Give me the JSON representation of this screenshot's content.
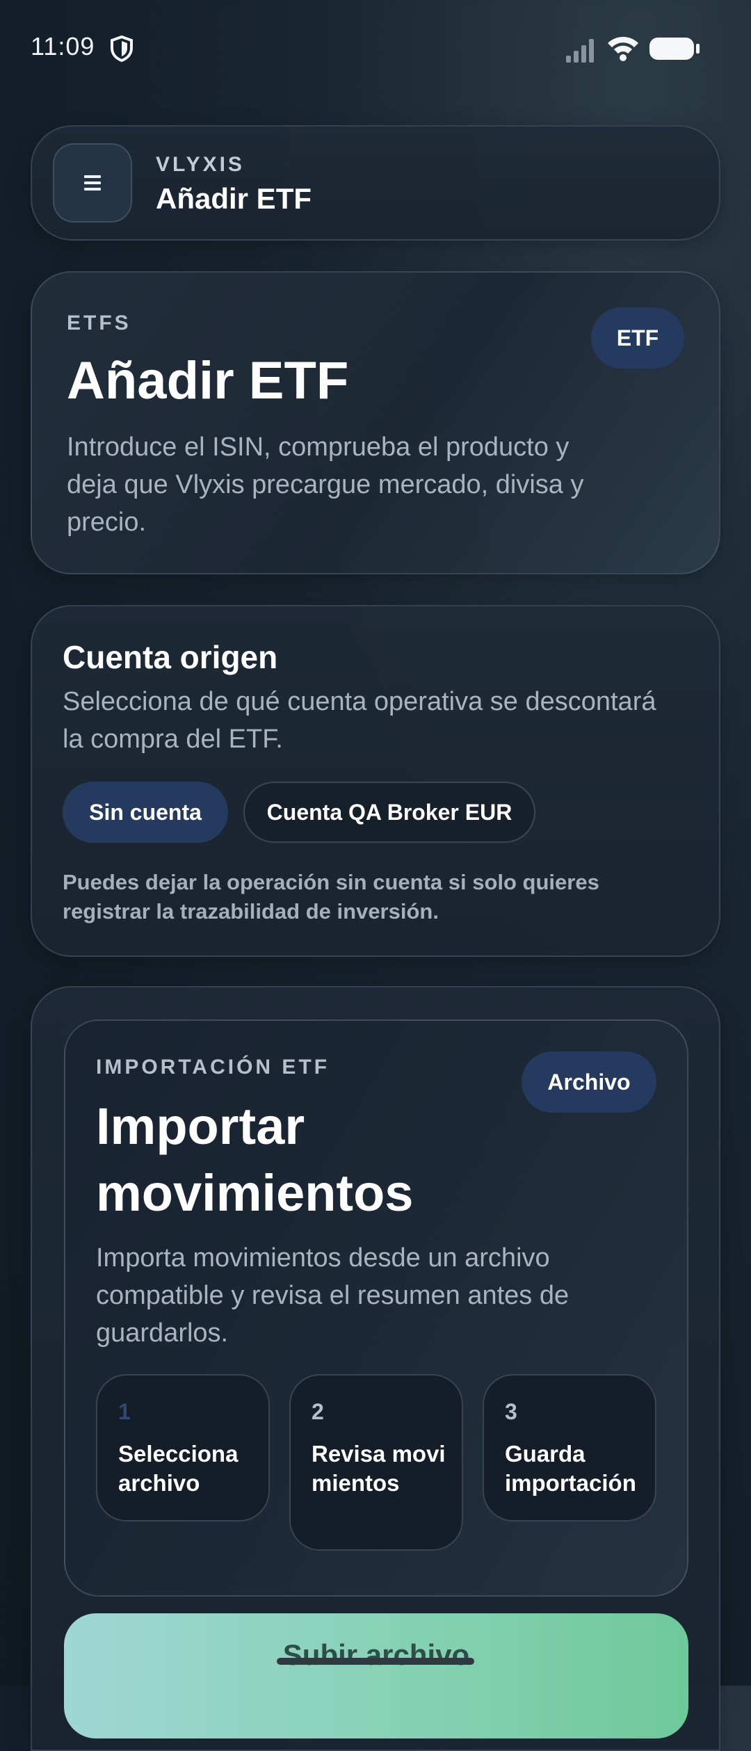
{
  "status_bar": {
    "time": "11:09",
    "icons": [
      "shield-icon",
      "signal-icon",
      "wifi-icon",
      "battery-icon"
    ]
  },
  "header": {
    "brand": "VLYXIS",
    "title": "Añadir ETF",
    "menu_icon": "menu-icon"
  },
  "hero": {
    "eyebrow": "ETFS",
    "badge": "ETF",
    "title": "Añadir ETF",
    "description": "Introduce el ISIN, comprueba el producto y deja que Vlyxis precargue mercado, divisa y precio."
  },
  "account": {
    "title": "Cuenta origen",
    "description": "Selecciona de qué cuenta operativa se descontará la compra del ETF.",
    "options": [
      {
        "label": "Sin cuenta",
        "selected": true
      },
      {
        "label": "Cuenta QA Broker EUR",
        "selected": false
      }
    ],
    "note": "Puedes dejar la operación sin cuenta si solo quieres registrar la trazabilidad de inversión."
  },
  "import": {
    "eyebrow": "IMPORTACIÓN ETF",
    "badge": "Archivo",
    "title": "Importar movimientos",
    "description": "Importa movimientos desde un archivo compatible y revisa el resumen antes de guardarlos.",
    "steps": [
      {
        "number": "1",
        "label": "Selecciona archivo"
      },
      {
        "number": "2",
        "label": "Revisa movimientos"
      },
      {
        "number": "3",
        "label": "Guarda importación"
      }
    ],
    "upload_button": "Subir archivo"
  },
  "colors": {
    "accent_chip": "#243a5e",
    "upload_gradient_start": "#9fd7d3",
    "upload_gradient_end": "#6fc99a"
  }
}
